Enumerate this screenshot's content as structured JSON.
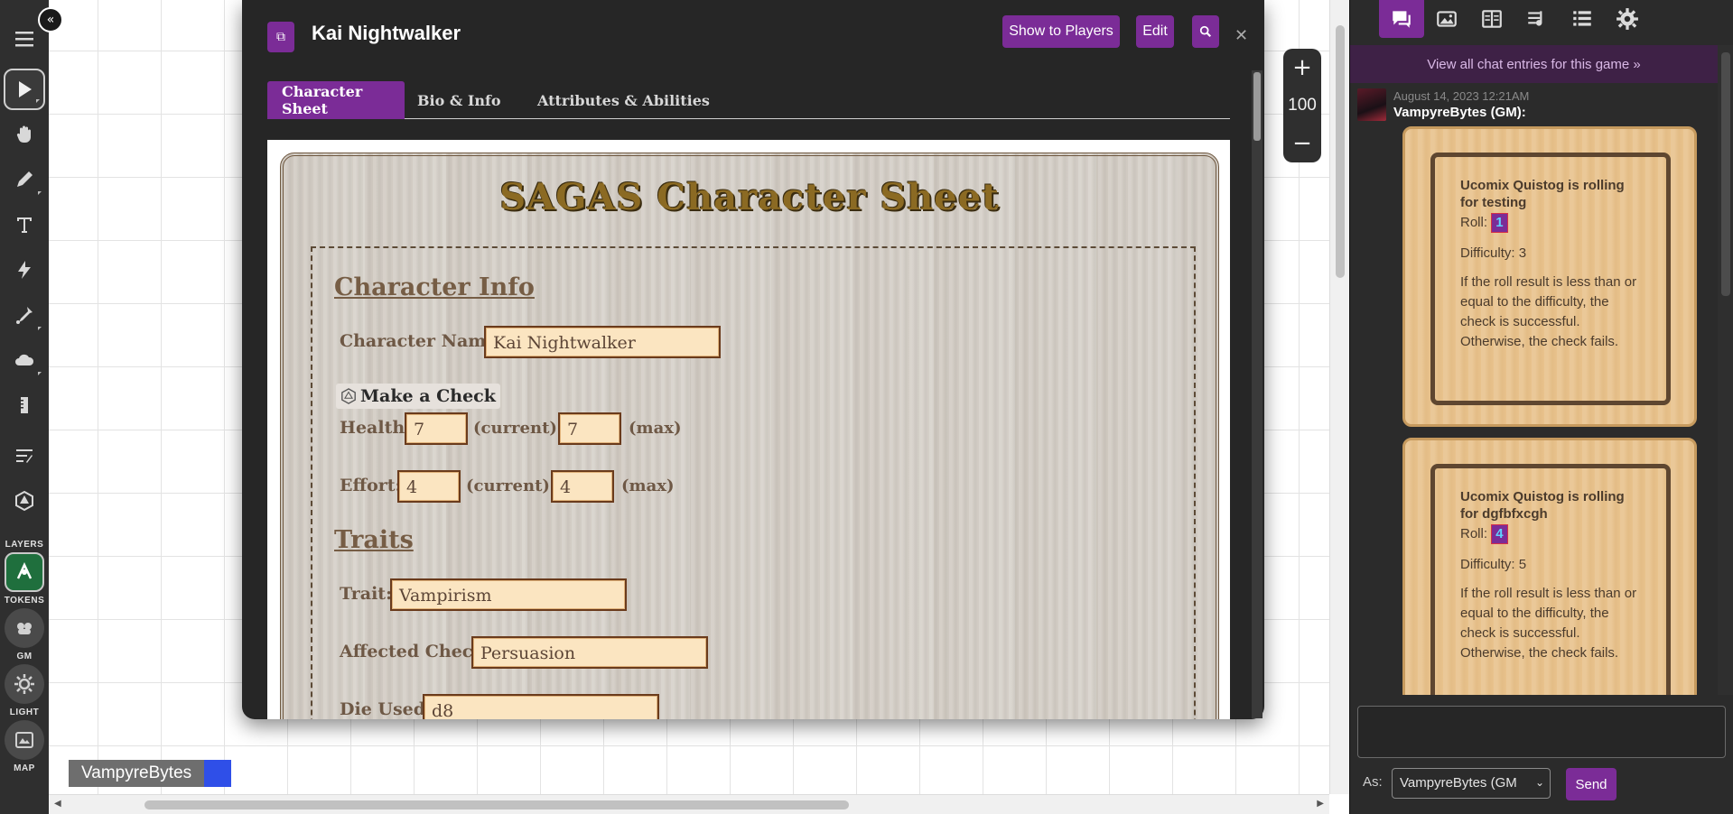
{
  "canvas": {
    "player_name": "VampyreBytes",
    "player_color": "#2f4fe8",
    "zoom_value": "100"
  },
  "toolbar": {
    "tools": [
      "menu-icon",
      "select-icon",
      "pan-icon",
      "draw-icon",
      "text-icon",
      "fx-icon",
      "dropper-icon",
      "fog-icon",
      "measure-icon",
      "turn-icon",
      "dice-icon"
    ],
    "layers": {
      "label": "LAYERS",
      "tokens": "TOKENS",
      "gm": "GM",
      "light": "LIGHT",
      "map": "MAP"
    }
  },
  "dialog": {
    "title": "Kai Nightwalker",
    "buttons": {
      "show_players": "Show to Players",
      "edit": "Edit"
    },
    "tabs": [
      "Character Sheet",
      "Bio & Info",
      "Attributes & Abilities"
    ],
    "active_tab": "Character Sheet"
  },
  "sheet": {
    "title": "SAGAS Character Sheet",
    "character_info": {
      "heading": "Character Info",
      "name_label": "Character Name:",
      "name_value": "Kai Nightwalker",
      "check_button": "Make a Check",
      "health_label": "Health:",
      "health_current": "7",
      "health_max": "7",
      "effort_label": "Effort:",
      "effort_current": "4",
      "effort_max": "4",
      "current_label": "(current) /",
      "max_label": "(max)"
    },
    "traits": {
      "heading": "Traits",
      "trait_label": "Trait:",
      "trait_value": "Vampirism",
      "affected_label": "Affected Check:",
      "affected_value": "Persuasion",
      "die_label": "Die Used:",
      "die_value": "d8"
    }
  },
  "chat": {
    "tabs": [
      "chat-icon",
      "art-icon",
      "journal-icon",
      "jukebox-icon",
      "collections-icon",
      "settings-icon"
    ],
    "view_all": "View all chat entries for this game »",
    "message": {
      "timestamp": "August 14, 2023 12:21AM",
      "author": "VampyreBytes (GM):",
      "rolls": [
        {
          "header": "Ucomix Quistog is rolling for testing",
          "roll_label": "Roll:",
          "roll_value": "1",
          "difficulty": "Difficulty: 3",
          "description": "If the roll result is less than or equal to the difficulty, the check is successful. Otherwise, the check fails."
        },
        {
          "header": "Ucomix Quistog is rolling for dgfbfxcgh",
          "roll_label": "Roll:",
          "roll_value": "4",
          "difficulty": "Difficulty: 5",
          "description": "If the roll result is less than or equal to the difficulty, the check is successful. Otherwise, the check fails."
        }
      ]
    },
    "as_label": "As:",
    "as_value": "VampyreBytes (GM",
    "send_label": "Send"
  }
}
